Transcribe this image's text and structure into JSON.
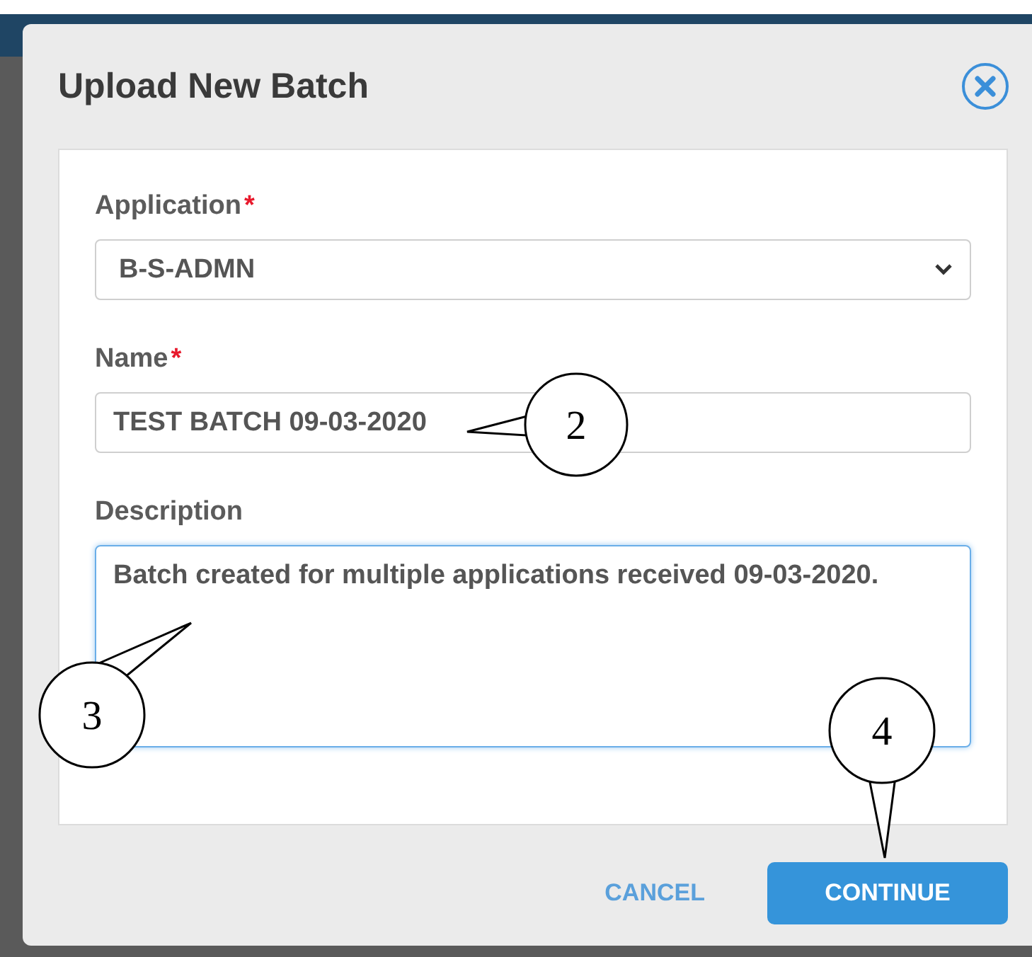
{
  "dialog": {
    "title": "Upload New Batch"
  },
  "fields": [
    {
      "kind": "select",
      "label": "Application",
      "required_mark": "*",
      "value": "B-S-ADMN",
      "focused": false
    },
    {
      "kind": "text",
      "label": "Name",
      "required_mark": "*",
      "value": "TEST BATCH 09-03-2020",
      "focused": false
    },
    {
      "kind": "textarea",
      "label": "Description",
      "value": "Batch created for multiple applications received 09-03-2020.",
      "focused": true
    }
  ],
  "buttons": [
    {
      "kind": "flat",
      "label": "CANCEL"
    },
    {
      "kind": "primary",
      "label": "CONTINUE"
    }
  ],
  "callouts": [
    {
      "number": "2",
      "kind": "right"
    },
    {
      "number": "3",
      "kind": "upright"
    },
    {
      "number": "4",
      "kind": "down"
    }
  ]
}
